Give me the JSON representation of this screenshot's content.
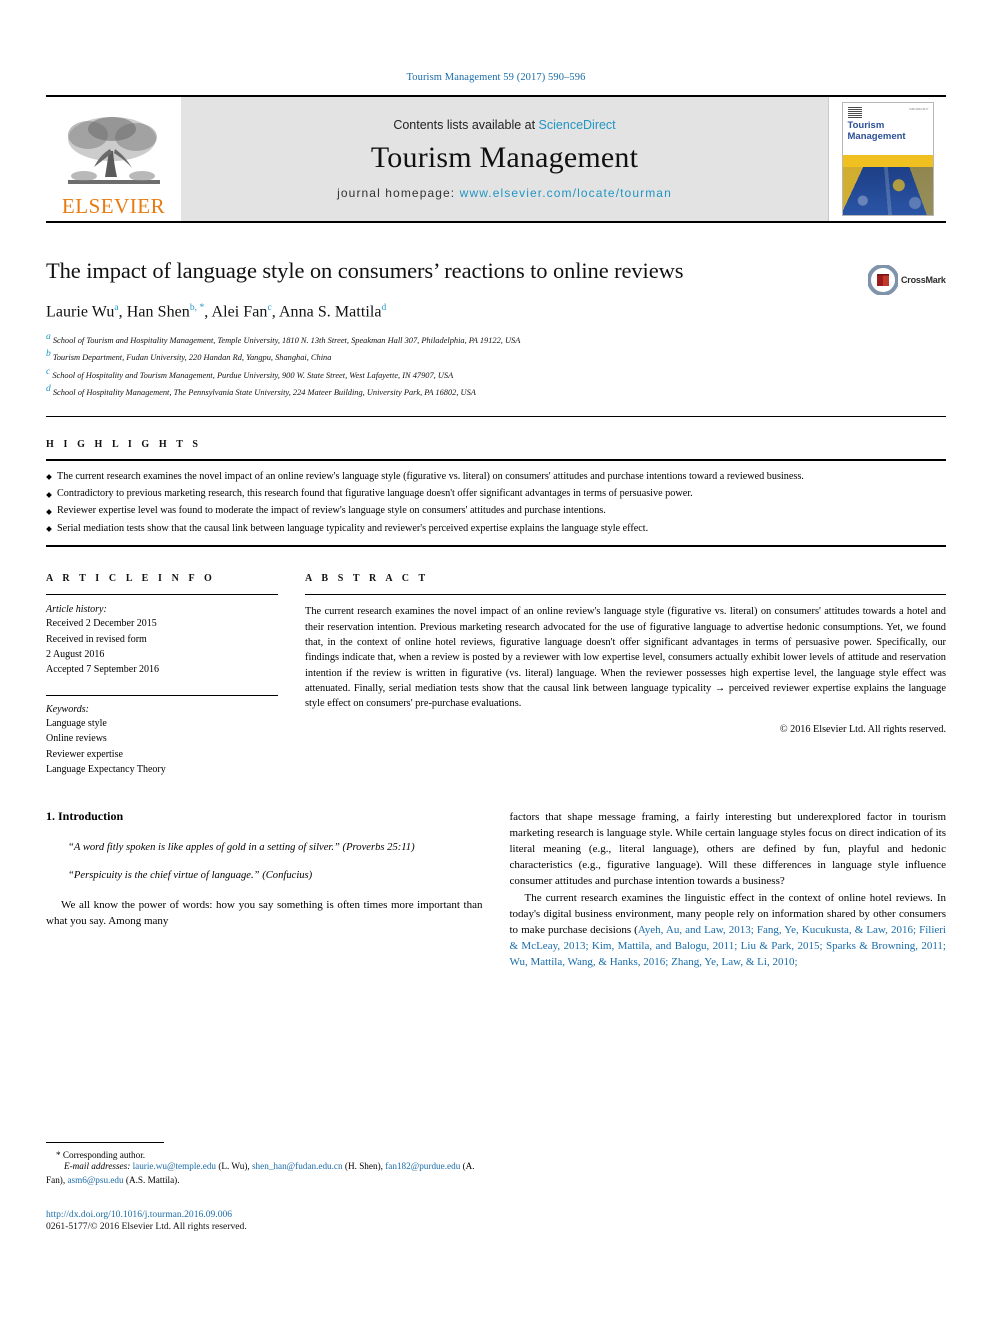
{
  "running_head": "Tourism Management 59 (2017) 590–596",
  "masthead": {
    "publisher_name": "ELSEVIER",
    "contents_prefix": "Contents lists available at ",
    "contents_link": "ScienceDirect",
    "journal_title": "Tourism Management",
    "homepage_prefix": "journal homepage: ",
    "homepage_url": "www.elsevier.com/locate/tourman",
    "cover_title_line1": "Tourism",
    "cover_title_line2": "Management",
    "cover_corner_text": "ISSN 0261-5177"
  },
  "article": {
    "title": "The impact of language style on consumers’ reactions to online reviews",
    "authors": [
      {
        "name": "Laurie Wu",
        "sup": "a"
      },
      {
        "name": "Han Shen",
        "sup": "b, *"
      },
      {
        "name": "Alei Fan",
        "sup": "c"
      },
      {
        "name": "Anna S. Mattila",
        "sup": "d"
      }
    ],
    "affiliations": [
      {
        "sup": "a",
        "text": "School of Tourism and Hospitality Management, Temple University, 1810 N. 13th Street, Speakman Hall 307, Philadelphia, PA 19122, USA"
      },
      {
        "sup": "b",
        "text": "Tourism Department, Fudan University, 220 Handan Rd, Yangpu, Shanghai, China"
      },
      {
        "sup": "c",
        "text": "School of Hospitality and Tourism Management, Purdue University, 900 W. State Street, West Lafayette, IN 47907, USA"
      },
      {
        "sup": "d",
        "text": "School of Hospitality Management, The Pennsylvania State University, 224 Mateer Building, University Park, PA 16802, USA"
      }
    ],
    "crossmark_label": "CrossMark"
  },
  "highlights": {
    "heading": "H I G H L I G H T S",
    "items": [
      "The current research examines the novel impact of an online review's language style (figurative vs. literal) on consumers' attitudes and purchase intentions toward a reviewed business.",
      "Contradictory to previous marketing research, this research found that figurative language doesn't offer significant advantages in terms of persuasive power.",
      "Reviewer expertise level was found to moderate the impact of review's language style on consumers' attitudes and purchase intentions.",
      "Serial mediation tests show that the causal link between language typicality and reviewer's perceived expertise explains the language style effect."
    ]
  },
  "article_info": {
    "heading": "A R T I C L E  I N F O",
    "history_label": "Article history:",
    "history_lines": [
      "Received 2 December 2015",
      "Received in revised form",
      "2 August 2016",
      "Accepted 7 September 2016"
    ],
    "keywords_label": "Keywords:",
    "keywords": [
      "Language style",
      "Online reviews",
      "Reviewer expertise",
      "Language Expectancy Theory"
    ]
  },
  "abstract": {
    "heading": "A B S T R A C T",
    "text": "The current research examines the novel impact of an online review's language style (figurative vs. literal) on consumers' attitudes towards a hotel and their reservation intention. Previous marketing research advocated for the use of figurative language to advertise hedonic consumptions. Yet, we found that, in the context of online hotel reviews, figurative language doesn't offer significant advantages in terms of persuasive power. Specifically, our findings indicate that, when a review is posted by a reviewer with low expertise level, consumers actually exhibit lower levels of attitude and reservation intention if the review is written in figurative (vs. literal) language. When the reviewer possesses high expertise level, the language style effect was attenuated. Finally, serial mediation tests show that the causal link between language typicality → perceived reviewer expertise explains the language style effect on consumers' pre-purchase evaluations.",
    "copyright": "© 2016 Elsevier Ltd. All rights reserved."
  },
  "body": {
    "section_heading": "1. Introduction",
    "quote1": "“A word fitly spoken is like apples of gold in a setting of silver.” (Proverbs 25:11)",
    "quote2": "“Perspicuity is the chief virtue of language.” (Confucius)",
    "left_para1": "We all know the power of words: how you say something is often times more important than what you say. Among many",
    "right_para1": "factors that shape message framing, a fairly interesting but underexplored factor in tourism marketing research is language style. While certain language styles focus on direct indication of its literal meaning (e.g., literal language), others are defined by fun, playful and hedonic characteristics (e.g., figurative language). Will these differences in language style influence consumer attitudes and purchase intention towards a business?",
    "right_para2_lead": "The current research examines the linguistic effect in the context of online hotel reviews. In today's digital business environment, many people rely on information shared by other consumers to make purchase decisions (",
    "right_para2_citations": "Ayeh, Au, and Law, 2013; Fang, Ye, Kucukusta, & Law, 2016; Filieri & McLeay, 2013; Kim, Mattila, and Balogu, 2011; Liu & Park, 2015; Sparks & Browning, 2011; Wu, Mattila, Wang, & Hanks, 2016; Zhang, Ye, Law, & Li, 2010;"
  },
  "footnotes": {
    "corresponding": "* Corresponding author.",
    "email_label": "E-mail addresses:",
    "emails": [
      {
        "address": "laurie.wu@temple.edu",
        "owner": "(L. Wu),"
      },
      {
        "address": "shen_han@fudan.edu.cn",
        "owner": "(H. Shen),"
      },
      {
        "address": "fan182@purdue.edu",
        "owner": "(A. Fan),"
      },
      {
        "address": "asm6@psu.edu",
        "owner": "(A.S. Mattila)."
      }
    ],
    "doi": "http://dx.doi.org/10.1016/j.tourman.2016.09.006",
    "issn": "0261-5177/© 2016 Elsevier Ltd. All rights reserved."
  },
  "colors": {
    "link_blue": "#1a6ca8",
    "sciencedirect_blue": "#2196c4",
    "elsevier_orange": "#e87b10",
    "cover_blue": "#2c4f96",
    "cover_yellow": "#f0c020"
  }
}
